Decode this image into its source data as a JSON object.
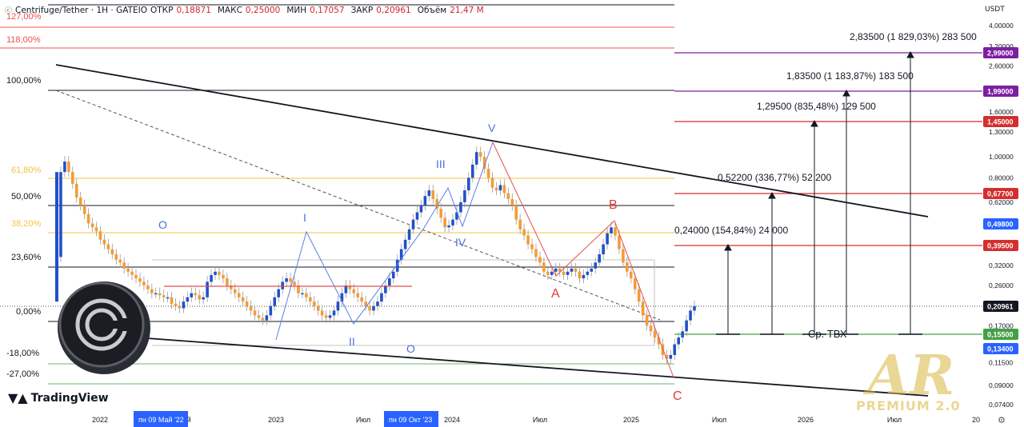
{
  "header": {
    "symbol": "Centrifuge/Tether · 1H · GATEIO",
    "open_label": "ОТКР",
    "open": "0,18871",
    "high_label": "МАКС",
    "high": "0,25000",
    "low_label": "МИН",
    "low": "0,17057",
    "close_label": "ЗАКР",
    "close": "0,20961",
    "volume_label": "Объём",
    "volume": "21,47 M"
  },
  "currency": "USDT",
  "branding": {
    "tradingview": "TradingView",
    "watermark_big": "AR",
    "watermark_small": "PREMIUM 2.0"
  },
  "chart_data": {
    "type": "candlestick",
    "price_axis": {
      "scale": "log",
      "ticks": [
        "4,00000",
        "3,20000",
        "2,60000",
        "2,00000",
        "1,60000",
        "1,30000",
        "1,00000",
        "0,80000",
        "0,62000",
        "0,50000",
        "0,40000",
        "0,32000",
        "0,26000",
        "0,21000",
        "0,17000",
        "0,13500",
        "0,11500",
        "0,09000",
        "0,07400"
      ],
      "tags": [
        {
          "label": "2,99000",
          "color": "#7b1fa2"
        },
        {
          "label": "1,99000",
          "color": "#7b1fa2"
        },
        {
          "label": "1,45000",
          "color": "#d32f2f"
        },
        {
          "label": "0,67700",
          "color": "#d32f2f"
        },
        {
          "label": "0,49800",
          "color": "#2962ff"
        },
        {
          "label": "0,39500",
          "color": "#d32f2f"
        },
        {
          "label": "0,20961",
          "color": "#131722"
        },
        {
          "label": "0,15500",
          "color": "#43a047"
        },
        {
          "label": "0,13400",
          "color": "#2962ff"
        }
      ]
    },
    "time_axis": {
      "labels": [
        "2022",
        "Май",
        "2023",
        "Июл",
        "2024",
        "Июл",
        "2025",
        "Июл",
        "2026",
        "Июл",
        "20"
      ],
      "highlights": [
        "пн 09 Май '22",
        "пн 09 Окт '23"
      ]
    },
    "fib_levels": [
      "127,00%",
      "118,00%",
      "100,00%",
      "61,80%",
      "50,00%",
      "38,20%",
      "23,60%",
      "0,00%",
      "-18,00%",
      "-27,00%"
    ],
    "wave_labels": [
      "I",
      "II",
      "III",
      "IV",
      "V",
      "A",
      "B",
      "C",
      "O",
      "O"
    ],
    "targets": [
      "0,24000 (154,84%) 24 000",
      "0,52200 (336,77%) 52 200",
      "1,29500 (835,48%) 129 500",
      "1,83500 (1 183,87%) 183 500",
      "2,83500 (1 829,03%) 283 500"
    ],
    "avg_label": "Ср. ТВХ",
    "series": [
      {
        "values": [
          0.35,
          0.85,
          0.95,
          0.85,
          0.75,
          0.65,
          0.6,
          0.55,
          0.5,
          0.48,
          0.46,
          0.42,
          0.4,
          0.38,
          0.36,
          0.34,
          0.33,
          0.31,
          0.3,
          0.29,
          0.28,
          0.27,
          0.26,
          0.25,
          0.24,
          0.24,
          0.235,
          0.23
        ]
      },
      {
        "values": [
          0.23,
          0.215,
          0.21,
          0.205,
          0.22,
          0.23,
          0.24,
          0.235,
          0.225,
          0.23,
          0.27,
          0.29,
          0.3,
          0.29,
          0.28,
          0.26,
          0.25,
          0.24,
          0.23,
          0.22,
          0.21,
          0.2,
          0.19,
          0.185,
          0.18,
          0.19,
          0.21,
          0.23,
          0.25,
          0.27,
          0.28,
          0.27,
          0.26,
          0.24
        ]
      },
      {
        "values": [
          0.24,
          0.23,
          0.22,
          0.21,
          0.2,
          0.19,
          0.185,
          0.19,
          0.2,
          0.22,
          0.24,
          0.26,
          0.25,
          0.24,
          0.23,
          0.22,
          0.21,
          0.2,
          0.21,
          0.22,
          0.24,
          0.26,
          0.28,
          0.3,
          0.34,
          0.38,
          0.42,
          0.47,
          0.52,
          0.56,
          0.6,
          0.66,
          0.7,
          0.64,
          0.58,
          0.53,
          0.48
        ]
      },
      {
        "values": [
          0.49,
          0.52,
          0.56,
          0.62,
          0.7,
          0.8,
          0.92,
          1.05,
          1.0,
          0.88,
          0.8,
          0.72,
          0.7,
          0.74,
          0.68,
          0.64,
          0.6,
          0.52,
          0.47,
          0.44,
          0.4,
          0.38,
          0.35,
          0.33,
          0.3,
          0.29,
          0.3,
          0.31,
          0.3,
          0.29,
          0.3,
          0.31,
          0.3,
          0.28,
          0.29,
          0.3,
          0.31,
          0.33,
          0.36,
          0.4,
          0.45,
          0.48,
          0.44,
          0.38,
          0.33,
          0.3,
          0.28,
          0.25,
          0.22,
          0.19,
          0.17,
          0.16,
          0.15,
          0.14,
          0.125,
          0.12,
          0.125,
          0.14,
          0.15,
          0.16,
          0.18,
          0.2,
          0.21
        ]
      }
    ]
  }
}
